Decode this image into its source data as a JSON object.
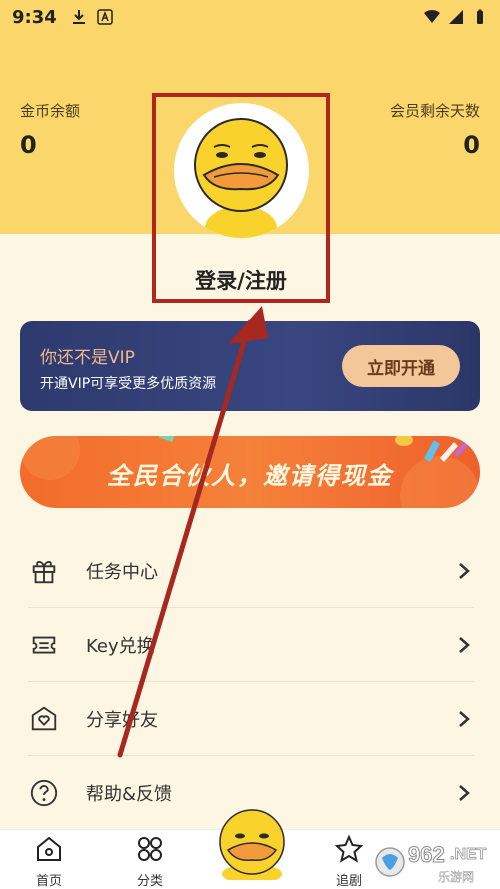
{
  "status_bar": {
    "time": "9:34"
  },
  "stats": {
    "coins_label": "金币余额",
    "coins_value": "0",
    "days_label": "会员剩余天数",
    "days_value": "0"
  },
  "login": {
    "label": "登录/注册"
  },
  "vip": {
    "title": "你还不是VIP",
    "subtitle": "开通VIP可享受更多优质资源",
    "button": "立即开通"
  },
  "banner": {
    "text": "全民合伙人，邀请得现金"
  },
  "menu": [
    {
      "label": "任务中心",
      "icon": "gift-icon"
    },
    {
      "label": "Key兑换",
      "icon": "ticket-icon"
    },
    {
      "label": "分享好友",
      "icon": "share-heart-icon"
    },
    {
      "label": "帮助&反馈",
      "icon": "help-icon"
    }
  ],
  "nav": [
    {
      "label": "首页",
      "icon": "home-icon"
    },
    {
      "label": "分类",
      "icon": "grid-icon"
    },
    {
      "label": "追剧",
      "icon": "star-icon"
    }
  ],
  "watermark": {
    "text": "962",
    "suffix": ".NET",
    "sub": "乐游网"
  },
  "colors": {
    "brand_yellow": "#fbd66a",
    "vip_navy": "#2d3a6e",
    "vip_button": "#f4c79a",
    "banner_orange": "#f26b2a",
    "annotation_red": "#b0251c"
  }
}
